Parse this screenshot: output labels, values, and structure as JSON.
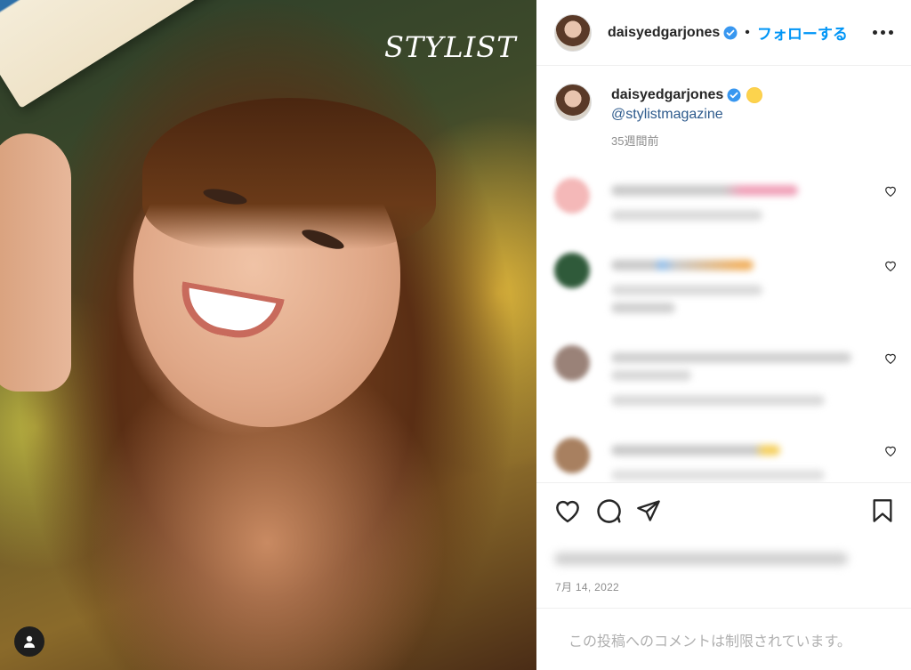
{
  "photo": {
    "brand_text": "STYLIST",
    "user_tag_icon": "user-icon"
  },
  "header": {
    "username": "daisyedgarjones",
    "separator": "•",
    "follow_label": "フォローする",
    "more_icon": "more-horizontal-icon"
  },
  "caption": {
    "username": "daisyedgarjones",
    "mention": "@stylistmagazine",
    "time_ago": "35週間前"
  },
  "actions": {
    "icons": [
      "heart-icon",
      "comment-icon",
      "share-icon",
      "bookmark-icon"
    ],
    "date": "7月 14, 2022"
  },
  "footer": {
    "restricted_text": "この投稿へのコメントは制限されています。"
  },
  "colors": {
    "link_blue": "#0095f6",
    "verified_blue": "#3897f0",
    "muted": "#8e8e8e"
  }
}
